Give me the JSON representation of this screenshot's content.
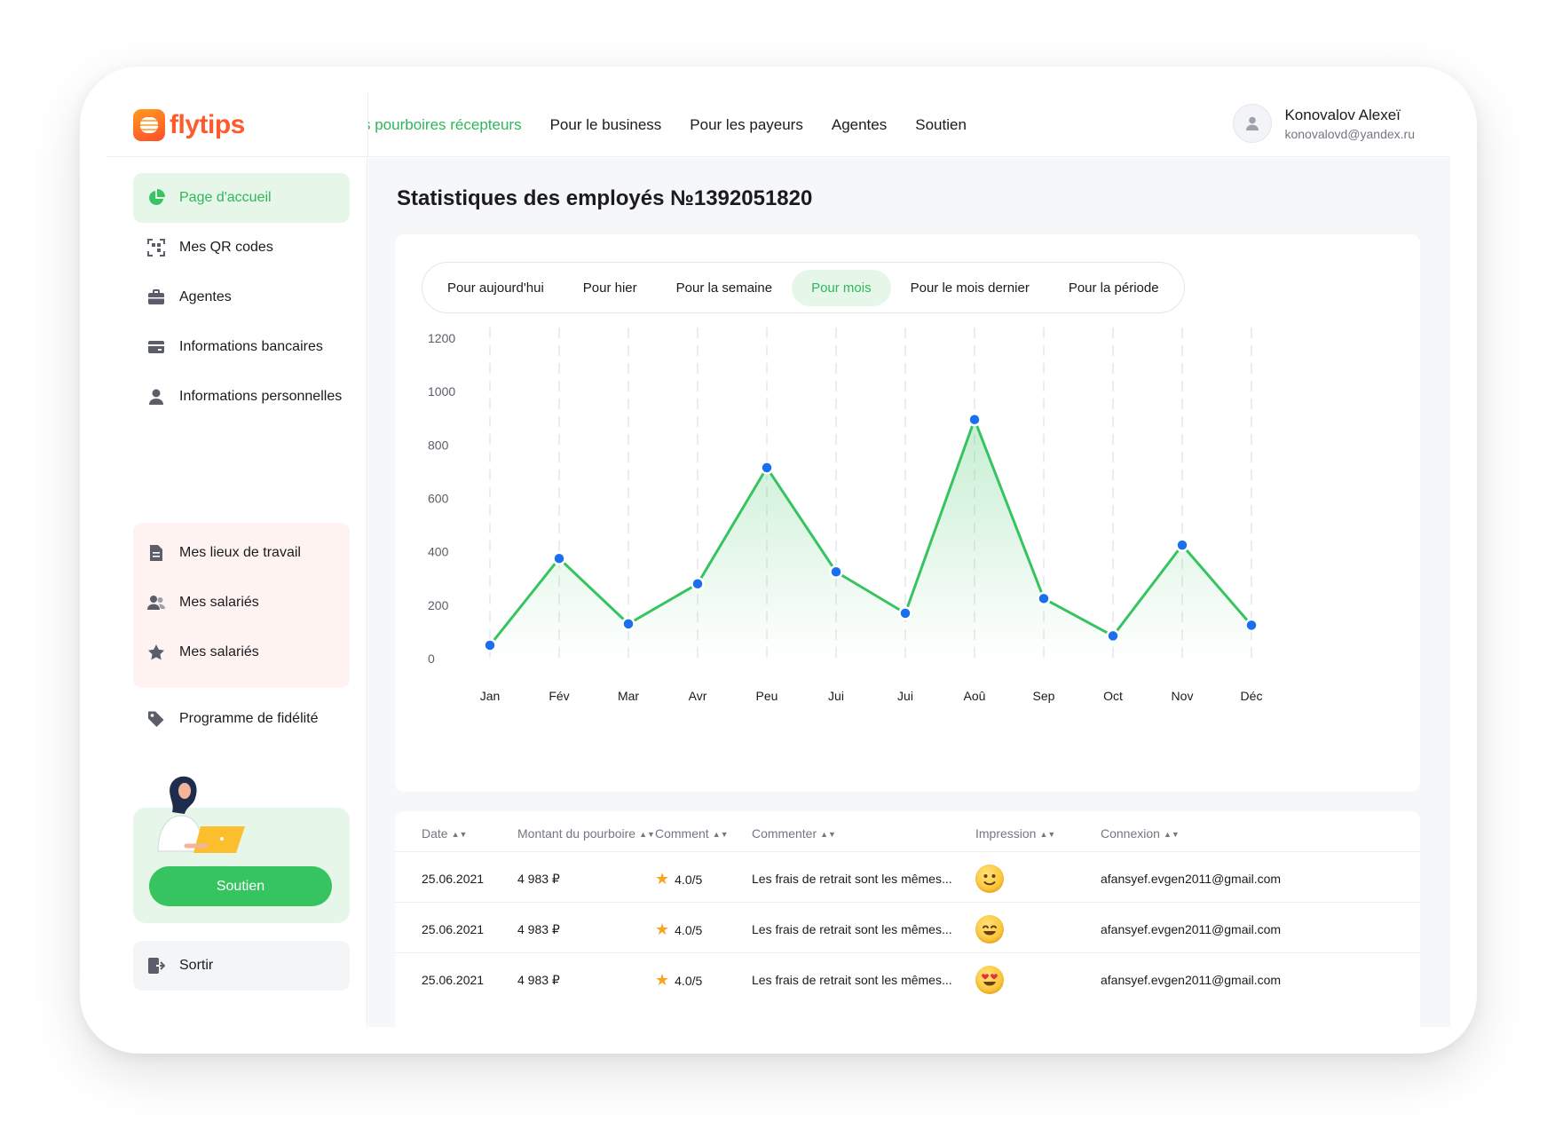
{
  "brand": {
    "name": "flytips",
    "color": "#ff5a2b",
    "accent": "#35c45f"
  },
  "top_nav": {
    "items": [
      {
        "label": "s pourboires récepteurs",
        "active": true
      },
      {
        "label": "Pour le business",
        "active": false
      },
      {
        "label": "Pour les payeurs",
        "active": false
      },
      {
        "label": "Agentes",
        "active": false
      },
      {
        "label": "Soutien",
        "active": false
      }
    ]
  },
  "user": {
    "name": "Konovalov Alexeï",
    "email": "konovalovd@yandex.ru",
    "icon": "user-icon"
  },
  "sidebar": {
    "items": [
      {
        "label": "Page d'accueil",
        "icon": "pie-chart-icon",
        "active": true
      },
      {
        "label": "Mes QR codes",
        "icon": "qr-code-icon"
      },
      {
        "label": "Agentes",
        "icon": "briefcase-icon"
      },
      {
        "label": "Informations bancaires",
        "icon": "card-icon"
      },
      {
        "label": "Informations personnelles",
        "icon": "person-icon"
      },
      {
        "label": "Mes lieux de travail",
        "icon": "document-icon"
      },
      {
        "label": "Mes salariés",
        "icon": "users-icon"
      },
      {
        "label": "Mes salariés",
        "icon": "star-icon"
      },
      {
        "label": "Programme de fidélité",
        "icon": "tag-icon"
      }
    ],
    "support_button": "Soutien",
    "logout": "Sortir"
  },
  "page": {
    "title": "Statistiques des employés №1392051820"
  },
  "filters": {
    "tabs": [
      "Pour aujourd'hui",
      "Pour hier",
      "Pour la semaine",
      "Pour mois",
      "Pour le mois dernier",
      "Pour la période"
    ],
    "active_index": 3
  },
  "chart_data": {
    "type": "line",
    "categories": [
      "Jan",
      "Fév",
      "Mar",
      "Avr",
      "Peu",
      "Jui",
      "Jui",
      "Aoû",
      "Sep",
      "Oct",
      "Nov",
      "Déc"
    ],
    "series": [
      {
        "values": [
          50,
          375,
          130,
          280,
          715,
          325,
          170,
          895,
          225,
          85,
          425,
          125
        ]
      }
    ],
    "y_ticks": [
      0,
      200,
      400,
      600,
      800,
      1000,
      1200
    ],
    "ylim": [
      0,
      1200
    ],
    "grid": "vertical dashed",
    "line_color": "#35c45f",
    "point_color": "#1a6ef0",
    "area_fill": "green gradient"
  },
  "table": {
    "columns": [
      "Date",
      "Montant du pourboire",
      "Comment",
      "Commenter",
      "Impression",
      "Connexion"
    ],
    "sort_icon": "sort-arrows-icon",
    "rows": [
      {
        "date": "25.06.2021",
        "amount": "4 983 ₽",
        "rating": "4.0/5",
        "comment": "Les frais de retrait sont les mêmes...",
        "impression": "slight-smile-emoji",
        "email": "afansyef.evgen2011@gmail.com"
      },
      {
        "date": "25.06.2021",
        "amount": "4 983 ₽",
        "rating": "4.0/5",
        "comment": "Les frais de retrait sont les mêmes...",
        "impression": "smile-emoji",
        "email": "afansyef.evgen2011@gmail.com"
      },
      {
        "date": "25.06.2021",
        "amount": "4 983 ₽",
        "rating": "4.0/5",
        "comment": "Les frais de retrait sont les mêmes...",
        "impression": "heart-eyes-emoji",
        "email": "afansyef.evgen2011@gmail.com"
      }
    ]
  }
}
